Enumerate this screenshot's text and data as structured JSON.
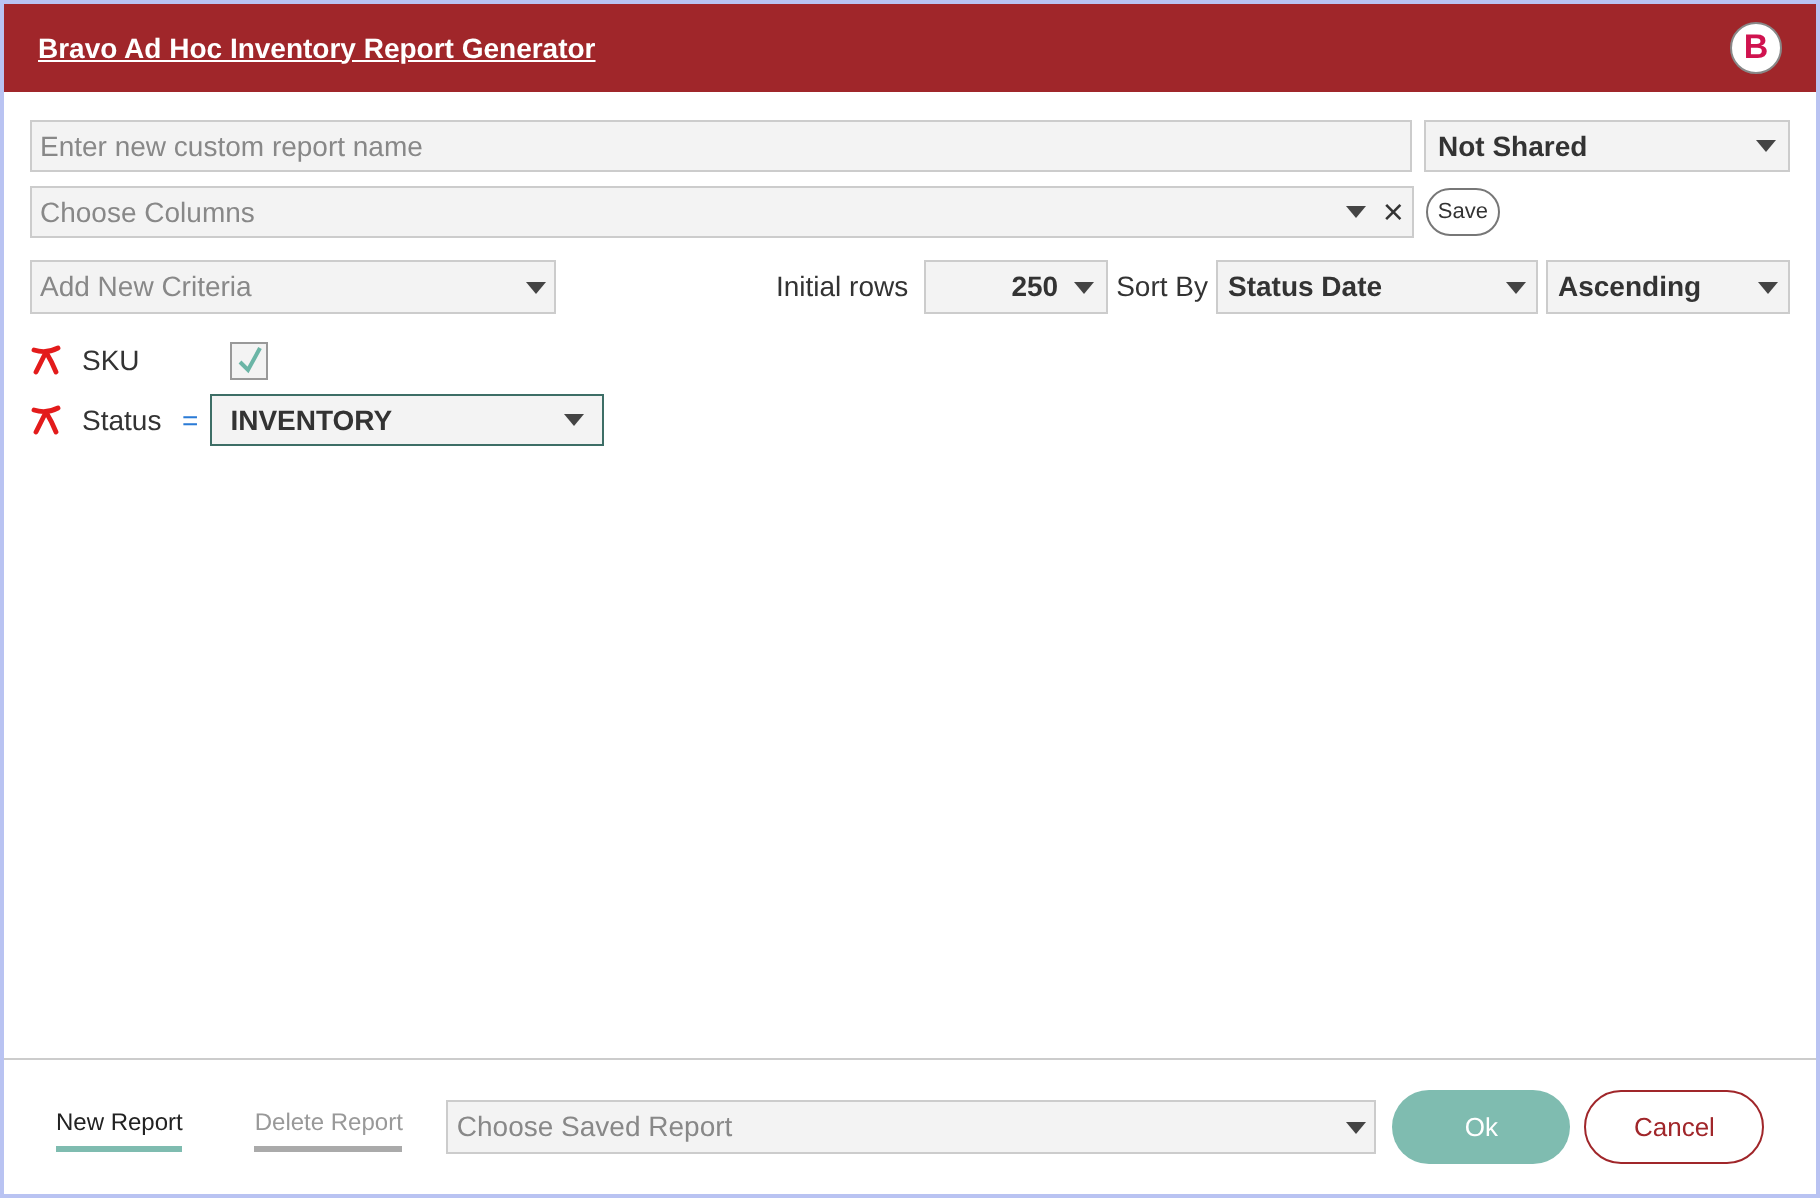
{
  "window": {
    "title": "Bravo Ad Hoc Inventory Report Generator",
    "logo": "B"
  },
  "report_name": {
    "placeholder": "Enter new custom report name"
  },
  "sharing": {
    "value": "Not Shared"
  },
  "columns": {
    "placeholder": "Choose Columns",
    "clear": "×",
    "save": "Save"
  },
  "add_criteria": {
    "placeholder": "Add New Criteria"
  },
  "initial_rows": {
    "label": "Initial rows",
    "value": "250"
  },
  "sort": {
    "label": "Sort By",
    "field": "Status Date",
    "order": "Ascending"
  },
  "criteria": [
    {
      "kind": "checkbox",
      "label": "SKU",
      "checked": true
    },
    {
      "kind": "select",
      "label": "Status",
      "operator": "=",
      "value": "INVENTORY"
    }
  ],
  "footer": {
    "tabs": [
      {
        "label": "New Report",
        "selected": true
      },
      {
        "label": "Delete Report",
        "selected": false
      }
    ],
    "saved_report": {
      "placeholder": "Choose Saved Report"
    },
    "ok": "Ok",
    "cancel": "Cancel"
  }
}
